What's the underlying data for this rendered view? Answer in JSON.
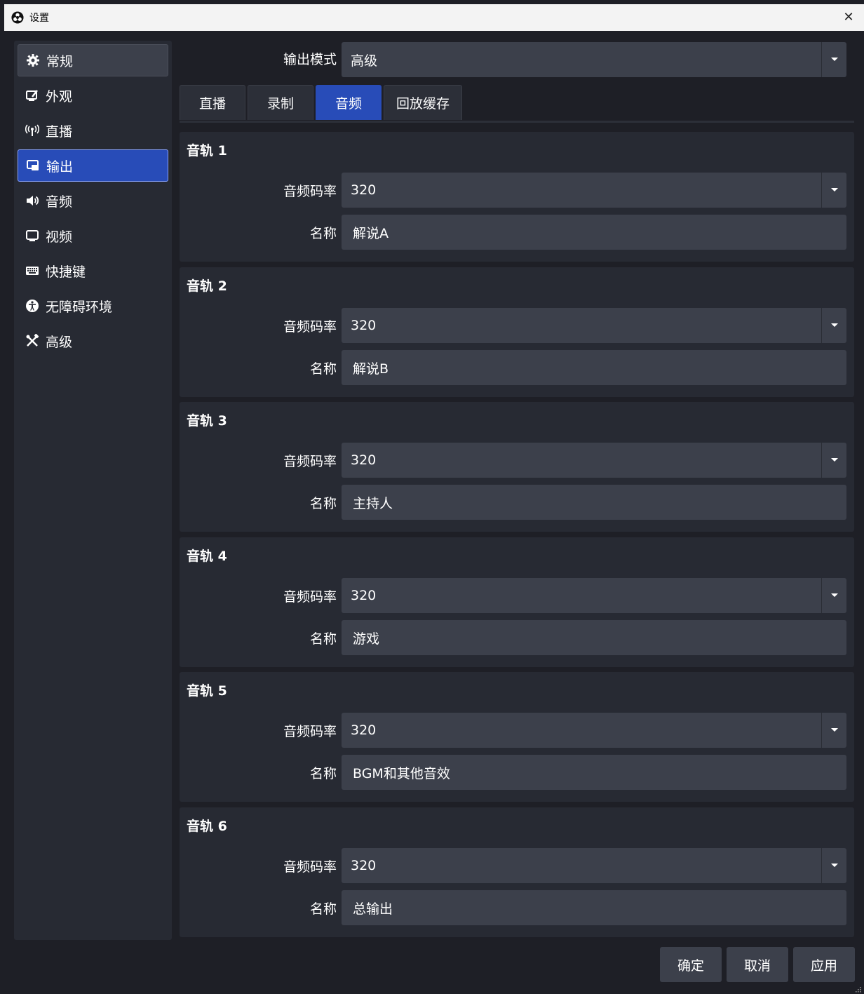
{
  "window": {
    "title": "设置",
    "close_glyph": "✕"
  },
  "sidebar": {
    "items": [
      {
        "label": "常规",
        "icon": "gear-icon"
      },
      {
        "label": "外观",
        "icon": "appearance-icon"
      },
      {
        "label": "直播",
        "icon": "broadcast-icon"
      },
      {
        "label": "输出",
        "icon": "output-icon"
      },
      {
        "label": "音频",
        "icon": "speaker-icon"
      },
      {
        "label": "视频",
        "icon": "monitor-icon"
      },
      {
        "label": "快捷键",
        "icon": "keyboard-icon"
      },
      {
        "label": "无障碍环境",
        "icon": "accessibility-icon"
      },
      {
        "label": "高级",
        "icon": "tools-icon"
      }
    ],
    "active_index": 3
  },
  "output_mode": {
    "label": "输出模式",
    "value": "高级"
  },
  "tabs": [
    {
      "label": "直播"
    },
    {
      "label": "录制"
    },
    {
      "label": "音频"
    },
    {
      "label": "回放缓存"
    }
  ],
  "active_tab": 2,
  "tracks": [
    {
      "title": "音轨 1",
      "bitrate_label": "音频码率",
      "bitrate": "320",
      "name_label": "名称",
      "name": "解说A"
    },
    {
      "title": "音轨 2",
      "bitrate_label": "音频码率",
      "bitrate": "320",
      "name_label": "名称",
      "name": "解说B"
    },
    {
      "title": "音轨 3",
      "bitrate_label": "音频码率",
      "bitrate": "320",
      "name_label": "名称",
      "name": "主持人"
    },
    {
      "title": "音轨 4",
      "bitrate_label": "音频码率",
      "bitrate": "320",
      "name_label": "名称",
      "name": "游戏"
    },
    {
      "title": "音轨 5",
      "bitrate_label": "音频码率",
      "bitrate": "320",
      "name_label": "名称",
      "name": "BGM和其他音效"
    },
    {
      "title": "音轨 6",
      "bitrate_label": "音频码率",
      "bitrate": "320",
      "name_label": "名称",
      "name": "总输出"
    }
  ],
  "buttons": {
    "ok": "确定",
    "cancel": "取消",
    "apply": "应用"
  },
  "colors": {
    "accent": "#284cb8",
    "panel": "#272a33",
    "field": "#3c404b",
    "background": "#1e1f26"
  }
}
